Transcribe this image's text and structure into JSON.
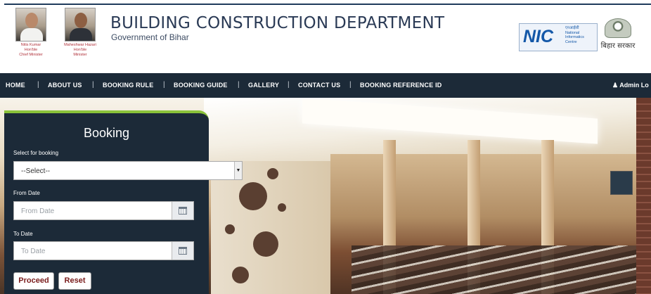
{
  "header": {
    "title": "BUILDING CONSTRUCTION DEPARTMENT",
    "subtitle": "Government of Bihar",
    "people": [
      {
        "name": "Nitis Kumar",
        "role": "Hon'ble",
        "position": "Chief Minister"
      },
      {
        "name": "Maheshwar Hazari",
        "role": "Hon'ble",
        "position": "Minister"
      }
    ],
    "nic": {
      "big": "NIC",
      "hindi": "एनआईसी",
      "line1": "National",
      "line2": "Informatics",
      "line3": "Centre"
    },
    "emblem_text": "बिहार सरकार"
  },
  "nav": {
    "items": [
      "HOME",
      "ABOUT US",
      "BOOKING RULE",
      "BOOKING GUIDE",
      "GALLERY",
      "CONTACT US",
      "BOOKING REFERENCE ID"
    ],
    "separator": "|",
    "admin": "Admin Lo"
  },
  "booking": {
    "heading": "Booking",
    "select_label": "Select for booking",
    "select_value": "--Select--",
    "from_label": "From Date",
    "from_placeholder": "From Date",
    "to_label": "To Date",
    "to_placeholder": "To Date",
    "proceed": "Proceed",
    "reset": "Reset"
  },
  "colors": {
    "nav_bg": "#1c2a38",
    "accent_green": "#8ac23a",
    "title_text": "#2a3a55",
    "button_text": "#7a1c1c"
  }
}
